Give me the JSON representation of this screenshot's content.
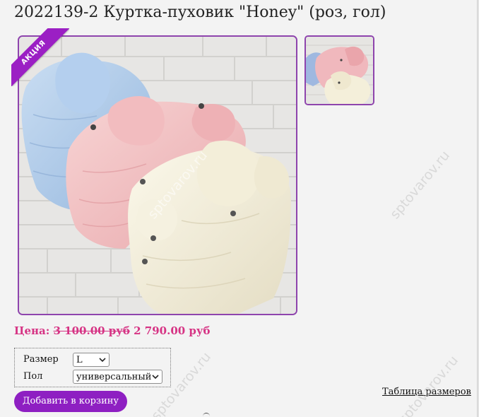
{
  "product": {
    "title": "2022139-2 Куртка-пуховик \"Honey\" (роз, гол)",
    "promo_badge": "АКЦИЯ",
    "price_label": "Цена:",
    "old_price": "3 100.00 руб",
    "new_price": "2 790.00 руб"
  },
  "options": {
    "size_label": "Размер",
    "size_value": "L",
    "gender_label": "Пол",
    "gender_value": "универсальный"
  },
  "actions": {
    "add_to_cart": "Добавить в корзину",
    "size_table_link": "Таблица размеров"
  },
  "watermark": "sptovarov.ru",
  "colors": {
    "accent": "#8e1fc2",
    "price": "#d63384",
    "frame": "#8e44ad"
  }
}
